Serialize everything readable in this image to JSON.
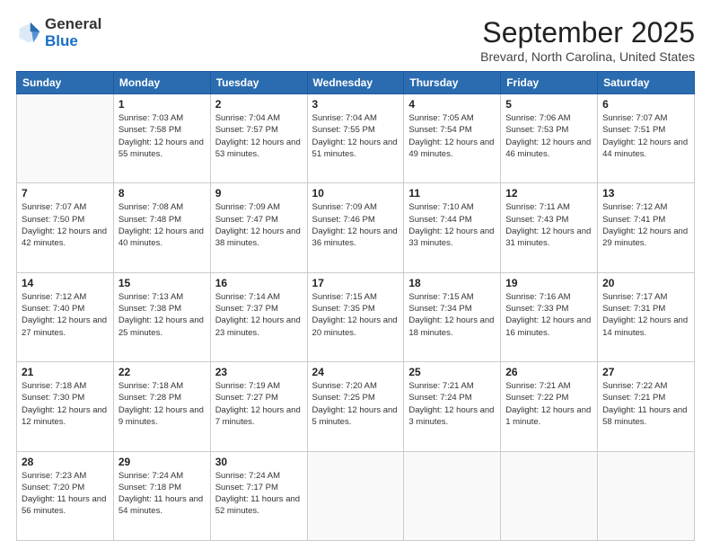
{
  "header": {
    "logo_general": "General",
    "logo_blue": "Blue",
    "month_title": "September 2025",
    "location": "Brevard, North Carolina, United States"
  },
  "weekdays": [
    "Sunday",
    "Monday",
    "Tuesday",
    "Wednesday",
    "Thursday",
    "Friday",
    "Saturday"
  ],
  "weeks": [
    [
      {
        "day": "",
        "sunrise": "",
        "sunset": "",
        "daylight": ""
      },
      {
        "day": "1",
        "sunrise": "Sunrise: 7:03 AM",
        "sunset": "Sunset: 7:58 PM",
        "daylight": "Daylight: 12 hours and 55 minutes."
      },
      {
        "day": "2",
        "sunrise": "Sunrise: 7:04 AM",
        "sunset": "Sunset: 7:57 PM",
        "daylight": "Daylight: 12 hours and 53 minutes."
      },
      {
        "day": "3",
        "sunrise": "Sunrise: 7:04 AM",
        "sunset": "Sunset: 7:55 PM",
        "daylight": "Daylight: 12 hours and 51 minutes."
      },
      {
        "day": "4",
        "sunrise": "Sunrise: 7:05 AM",
        "sunset": "Sunset: 7:54 PM",
        "daylight": "Daylight: 12 hours and 49 minutes."
      },
      {
        "day": "5",
        "sunrise": "Sunrise: 7:06 AM",
        "sunset": "Sunset: 7:53 PM",
        "daylight": "Daylight: 12 hours and 46 minutes."
      },
      {
        "day": "6",
        "sunrise": "Sunrise: 7:07 AM",
        "sunset": "Sunset: 7:51 PM",
        "daylight": "Daylight: 12 hours and 44 minutes."
      }
    ],
    [
      {
        "day": "7",
        "sunrise": "Sunrise: 7:07 AM",
        "sunset": "Sunset: 7:50 PM",
        "daylight": "Daylight: 12 hours and 42 minutes."
      },
      {
        "day": "8",
        "sunrise": "Sunrise: 7:08 AM",
        "sunset": "Sunset: 7:48 PM",
        "daylight": "Daylight: 12 hours and 40 minutes."
      },
      {
        "day": "9",
        "sunrise": "Sunrise: 7:09 AM",
        "sunset": "Sunset: 7:47 PM",
        "daylight": "Daylight: 12 hours and 38 minutes."
      },
      {
        "day": "10",
        "sunrise": "Sunrise: 7:09 AM",
        "sunset": "Sunset: 7:46 PM",
        "daylight": "Daylight: 12 hours and 36 minutes."
      },
      {
        "day": "11",
        "sunrise": "Sunrise: 7:10 AM",
        "sunset": "Sunset: 7:44 PM",
        "daylight": "Daylight: 12 hours and 33 minutes."
      },
      {
        "day": "12",
        "sunrise": "Sunrise: 7:11 AM",
        "sunset": "Sunset: 7:43 PM",
        "daylight": "Daylight: 12 hours and 31 minutes."
      },
      {
        "day": "13",
        "sunrise": "Sunrise: 7:12 AM",
        "sunset": "Sunset: 7:41 PM",
        "daylight": "Daylight: 12 hours and 29 minutes."
      }
    ],
    [
      {
        "day": "14",
        "sunrise": "Sunrise: 7:12 AM",
        "sunset": "Sunset: 7:40 PM",
        "daylight": "Daylight: 12 hours and 27 minutes."
      },
      {
        "day": "15",
        "sunrise": "Sunrise: 7:13 AM",
        "sunset": "Sunset: 7:38 PM",
        "daylight": "Daylight: 12 hours and 25 minutes."
      },
      {
        "day": "16",
        "sunrise": "Sunrise: 7:14 AM",
        "sunset": "Sunset: 7:37 PM",
        "daylight": "Daylight: 12 hours and 23 minutes."
      },
      {
        "day": "17",
        "sunrise": "Sunrise: 7:15 AM",
        "sunset": "Sunset: 7:35 PM",
        "daylight": "Daylight: 12 hours and 20 minutes."
      },
      {
        "day": "18",
        "sunrise": "Sunrise: 7:15 AM",
        "sunset": "Sunset: 7:34 PM",
        "daylight": "Daylight: 12 hours and 18 minutes."
      },
      {
        "day": "19",
        "sunrise": "Sunrise: 7:16 AM",
        "sunset": "Sunset: 7:33 PM",
        "daylight": "Daylight: 12 hours and 16 minutes."
      },
      {
        "day": "20",
        "sunrise": "Sunrise: 7:17 AM",
        "sunset": "Sunset: 7:31 PM",
        "daylight": "Daylight: 12 hours and 14 minutes."
      }
    ],
    [
      {
        "day": "21",
        "sunrise": "Sunrise: 7:18 AM",
        "sunset": "Sunset: 7:30 PM",
        "daylight": "Daylight: 12 hours and 12 minutes."
      },
      {
        "day": "22",
        "sunrise": "Sunrise: 7:18 AM",
        "sunset": "Sunset: 7:28 PM",
        "daylight": "Daylight: 12 hours and 9 minutes."
      },
      {
        "day": "23",
        "sunrise": "Sunrise: 7:19 AM",
        "sunset": "Sunset: 7:27 PM",
        "daylight": "Daylight: 12 hours and 7 minutes."
      },
      {
        "day": "24",
        "sunrise": "Sunrise: 7:20 AM",
        "sunset": "Sunset: 7:25 PM",
        "daylight": "Daylight: 12 hours and 5 minutes."
      },
      {
        "day": "25",
        "sunrise": "Sunrise: 7:21 AM",
        "sunset": "Sunset: 7:24 PM",
        "daylight": "Daylight: 12 hours and 3 minutes."
      },
      {
        "day": "26",
        "sunrise": "Sunrise: 7:21 AM",
        "sunset": "Sunset: 7:22 PM",
        "daylight": "Daylight: 12 hours and 1 minute."
      },
      {
        "day": "27",
        "sunrise": "Sunrise: 7:22 AM",
        "sunset": "Sunset: 7:21 PM",
        "daylight": "Daylight: 11 hours and 58 minutes."
      }
    ],
    [
      {
        "day": "28",
        "sunrise": "Sunrise: 7:23 AM",
        "sunset": "Sunset: 7:20 PM",
        "daylight": "Daylight: 11 hours and 56 minutes."
      },
      {
        "day": "29",
        "sunrise": "Sunrise: 7:24 AM",
        "sunset": "Sunset: 7:18 PM",
        "daylight": "Daylight: 11 hours and 54 minutes."
      },
      {
        "day": "30",
        "sunrise": "Sunrise: 7:24 AM",
        "sunset": "Sunset: 7:17 PM",
        "daylight": "Daylight: 11 hours and 52 minutes."
      },
      {
        "day": "",
        "sunrise": "",
        "sunset": "",
        "daylight": ""
      },
      {
        "day": "",
        "sunrise": "",
        "sunset": "",
        "daylight": ""
      },
      {
        "day": "",
        "sunrise": "",
        "sunset": "",
        "daylight": ""
      },
      {
        "day": "",
        "sunrise": "",
        "sunset": "",
        "daylight": ""
      }
    ]
  ]
}
